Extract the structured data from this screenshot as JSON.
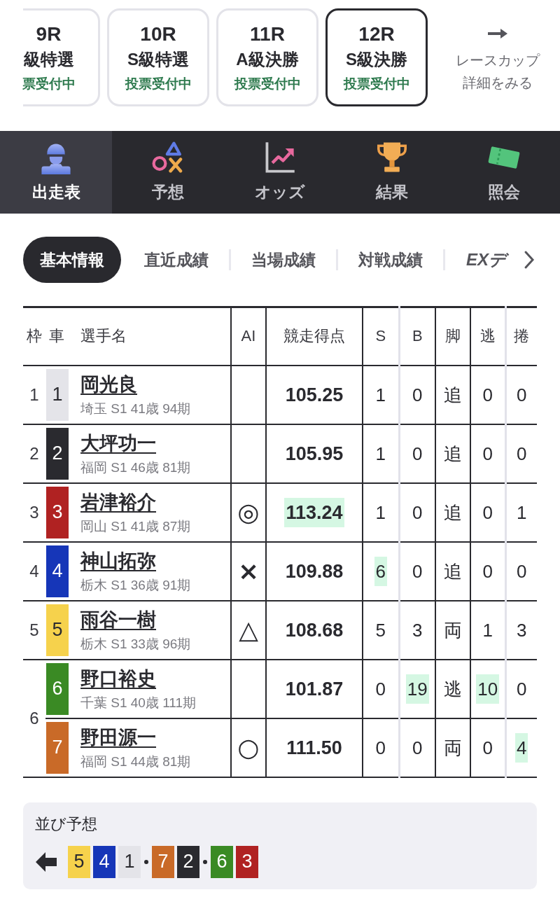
{
  "race_tabs": [
    {
      "number": "9R",
      "grade": "級特選",
      "status": "票受付中",
      "selected": false
    },
    {
      "number": "10R",
      "grade": "S級特選",
      "status": "投票受付中",
      "selected": false
    },
    {
      "number": "11R",
      "grade": "A級決勝",
      "status": "投票受付中",
      "selected": false
    },
    {
      "number": "12R",
      "grade": "S級決勝",
      "status": "投票受付中",
      "selected": true
    }
  ],
  "race_cup_link": {
    "lines": [
      "レースカップ",
      "詳細をみる"
    ]
  },
  "main_nav": [
    {
      "label": "出走表",
      "selected": true
    },
    {
      "label": "予想",
      "selected": false
    },
    {
      "label": "オッズ",
      "selected": false
    },
    {
      "label": "結果",
      "selected": false
    },
    {
      "label": "照会",
      "selected": false
    }
  ],
  "sub_tabs": [
    {
      "label": "基本情報",
      "kind": "text",
      "selected": true
    },
    {
      "label": "直近成績",
      "kind": "text",
      "selected": false
    },
    {
      "label": "当場成績",
      "kind": "text",
      "selected": false
    },
    {
      "label": "対戦成績",
      "kind": "text",
      "selected": false
    },
    {
      "label": "EXデ",
      "kind": "logo",
      "selected": false
    }
  ],
  "table": {
    "columns": [
      "枠",
      "車",
      "選手名",
      "AI",
      "競走得点",
      "S",
      "B",
      "脚",
      "逃",
      "捲"
    ],
    "brackets": [
      {
        "label": "1",
        "riders": [
          {
            "number": "1",
            "color": "#e4e4e9",
            "name": "岡光良",
            "info": "埼玉 S1 41歳 94期",
            "cells": [
              {
                "text": "105.25",
                "highlighted": false
              },
              {
                "text": "1",
                "highlighted": false
              },
              {
                "text": "0",
                "highlighted": false
              },
              {
                "text": "追",
                "highlighted": false
              },
              {
                "text": "0",
                "highlighted": false
              },
              {
                "text": "0",
                "highlighted": false
              }
            ]
          }
        ]
      },
      {
        "label": "2",
        "riders": [
          {
            "number": "2",
            "color": "#2a2a2f",
            "name": "大坪功一",
            "info": "福岡 S1 46歳 81期",
            "cells": [
              {
                "text": "105.95",
                "highlighted": false
              },
              {
                "text": "1",
                "highlighted": false
              },
              {
                "text": "0",
                "highlighted": false
              },
              {
                "text": "追",
                "highlighted": false
              },
              {
                "text": "0",
                "highlighted": false
              },
              {
                "text": "0",
                "highlighted": false
              }
            ]
          }
        ]
      },
      {
        "label": "3",
        "riders": [
          {
            "number": "3",
            "color": "#b02222",
            "name": "岩津裕介",
            "info": "岡山 S1 41歳 87期",
            "ai_mark": "◎",
            "cells": [
              {
                "text": "113.24",
                "highlighted": true
              },
              {
                "text": "1",
                "highlighted": false
              },
              {
                "text": "0",
                "highlighted": false
              },
              {
                "text": "追",
                "highlighted": false
              },
              {
                "text": "0",
                "highlighted": false
              },
              {
                "text": "1",
                "highlighted": false
              }
            ]
          }
        ]
      },
      {
        "label": "4",
        "riders": [
          {
            "number": "4",
            "color": "#1636b8",
            "name": "神山拓弥",
            "info": "栃木 S1 36歳 91期",
            "ai_mark": "×",
            "cells": [
              {
                "text": "109.88",
                "highlighted": false
              },
              {
                "text": "6",
                "highlighted": true
              },
              {
                "text": "0",
                "highlighted": false
              },
              {
                "text": "追",
                "highlighted": false
              },
              {
                "text": "0",
                "highlighted": false
              },
              {
                "text": "0",
                "highlighted": false
              }
            ]
          }
        ]
      },
      {
        "label": "5",
        "riders": [
          {
            "number": "5",
            "color": "#f6d24c",
            "name": "雨谷一樹",
            "info": "栃木 S1 33歳 96期",
            "ai_mark": "△",
            "cells": [
              {
                "text": "108.68",
                "highlighted": false
              },
              {
                "text": "5",
                "highlighted": false
              },
              {
                "text": "3",
                "highlighted": false
              },
              {
                "text": "両",
                "highlighted": false
              },
              {
                "text": "1",
                "highlighted": false
              },
              {
                "text": "3",
                "highlighted": false
              }
            ]
          }
        ]
      },
      {
        "label": "6",
        "riders": [
          {
            "number": "6",
            "color": "#3a8a24",
            "name": "野口裕史",
            "info": "千葉 S1 40歳 111期",
            "cells": [
              {
                "text": "101.87",
                "highlighted": false
              },
              {
                "text": "0",
                "highlighted": false
              },
              {
                "text": "19",
                "highlighted": true
              },
              {
                "text": "逃",
                "highlighted": false
              },
              {
                "text": "10",
                "highlighted": true
              },
              {
                "text": "0",
                "highlighted": false
              }
            ]
          },
          {
            "number": "7",
            "color": "#c96a28",
            "name": "野田源一",
            "info": "福岡 S1 44歳 81期",
            "ai_mark": "○",
            "cells": [
              {
                "text": "111.50",
                "highlighted": false
              },
              {
                "text": "0",
                "highlighted": false
              },
              {
                "text": "0",
                "highlighted": false
              },
              {
                "text": "両",
                "highlighted": false
              },
              {
                "text": "0",
                "highlighted": false
              },
              {
                "text": "4",
                "highlighted": true
              }
            ]
          }
        ]
      }
    ]
  },
  "line_prediction": {
    "title": "並び予想",
    "groups": [
      [
        {
          "number": "5",
          "color": "#f6d24c"
        },
        {
          "number": "4",
          "color": "#1636b8"
        },
        {
          "number": "1",
          "color": "#e4e4e9"
        }
      ],
      [
        {
          "number": "7",
          "color": "#c96a28"
        },
        {
          "number": "2",
          "color": "#2a2a2f"
        }
      ],
      [
        {
          "number": "6",
          "color": "#3a8a24"
        },
        {
          "number": "3",
          "color": "#b02222"
        }
      ]
    ]
  }
}
